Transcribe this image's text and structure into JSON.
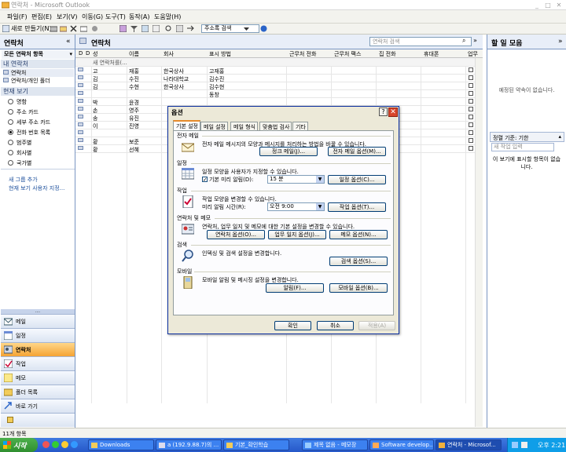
{
  "window": {
    "title": "연락처 - Microsoft Outlook",
    "icon": "outlook-icon"
  },
  "menu": [
    "파일(F)",
    "편집(E)",
    "보기(V)",
    "이동(G)",
    "도구(T)",
    "동작(A)",
    "도움말(H)"
  ],
  "toolbar": {
    "new_label": "새로 만들기(N)",
    "address_placeholder": "주소록 검색"
  },
  "nav": {
    "title": "연락처",
    "all_contacts_label": "모든 연락처 항목",
    "my_contacts_header": "내 연락처",
    "contacts_items": [
      "연락처",
      "연락처/개인 폴더"
    ],
    "current_view_header": "현재 보기",
    "views": [
      "명함",
      "주소 카드",
      "세부 주소 카드",
      "전화 번호 목록",
      "범주별",
      "회사별",
      "국가별"
    ],
    "selected_view": "전화 번호 목록",
    "links": [
      "새 그룹 추가",
      "현재 보기 사용자 지정..."
    ],
    "buttons": [
      {
        "label": "메일",
        "icon": "mail-icon"
      },
      {
        "label": "일정",
        "icon": "calendar-icon"
      },
      {
        "label": "연락처",
        "icon": "contacts-icon"
      },
      {
        "label": "작업",
        "icon": "tasks-icon"
      },
      {
        "label": "메모",
        "icon": "notes-icon"
      },
      {
        "label": "폴더 목록",
        "icon": "folder-icon"
      },
      {
        "label": "바로 가기",
        "icon": "shortcut-icon"
      }
    ],
    "active_button": "연락처"
  },
  "main": {
    "title": "연락처",
    "search_placeholder": "연락처 검색",
    "columns": [
      "성",
      "이름",
      "회사",
      "표시 방법",
      "근무처 전화",
      "근무처 팩스",
      "집 전화",
      "휴대폰",
      "업무"
    ],
    "new_row_placeholder": "새 연락처를(...",
    "rows": [
      {
        "last": "고",
        "first": "재홍",
        "company": "한국상사",
        "display": "고재홍"
      },
      {
        "last": "김",
        "first": "수진",
        "company": "나라대학교",
        "display": "김수진"
      },
      {
        "last": "김",
        "first": "수현",
        "company": "한국상사",
        "display": "김수현"
      },
      {
        "last": "",
        "first": "",
        "company": "",
        "display": "동창"
      },
      {
        "last": "박",
        "first": "윤경",
        "company": "",
        "display": ""
      },
      {
        "last": "손",
        "first": "영주",
        "company": "",
        "display": ""
      },
      {
        "last": "송",
        "first": "유진",
        "company": "",
        "display": ""
      },
      {
        "last": "이",
        "first": "진영",
        "company": "",
        "display": ""
      },
      {
        "last": "",
        "first": "",
        "company": "",
        "display": ""
      },
      {
        "last": "황",
        "first": "보준",
        "company": "",
        "display": ""
      },
      {
        "last": "황",
        "first": "선혜",
        "company": "",
        "display": ""
      }
    ]
  },
  "todo": {
    "title": "할 일 모음",
    "no_appointments": "예정된 약속이 없습니다.",
    "arrange_label": "정렬 기준: 기한",
    "new_task_placeholder": "새 작업 입력",
    "empty_message": "이 보기에 표시할 항목이 없습니다."
  },
  "status": {
    "item_count": "11개 항목"
  },
  "dialog": {
    "title": "옵션",
    "tabs": [
      "기본 설정",
      "메일 설정",
      "메일 형식",
      "맞춤법 검사",
      "기타"
    ],
    "active_tab": "기본 설정",
    "sections": {
      "mail": {
        "heading": "전자 메일",
        "desc": "전자 메일 메시지의 모양과 메시지를 처리하는 방법을 바꿀 수 있습니다.",
        "btn1": "정크 메일(J)...",
        "btn2": "전자 메일 옵션(M)..."
      },
      "calendar": {
        "heading": "일정",
        "desc": "일정 모양을 사용자가 지정할 수 있습니다.",
        "reminder_label": "기본 미리 알림(D):",
        "reminder_checked": true,
        "reminder_value": "15 분",
        "btn": "일정 옵션(C)..."
      },
      "tasks": {
        "heading": "작업",
        "desc": "작업 모양을 변경할 수 있습니다.",
        "time_label": "미리 알림 시간(R):",
        "time_value": "오전 9:00",
        "btn": "작업 옵션(T)..."
      },
      "contacts": {
        "heading": "연락처 및 메모",
        "desc": "연락처, 업무 일지 및 메모에 대한 기본 설정을 변경할 수 있습니다.",
        "btn1": "연락처 옵션(O)...",
        "btn2": "업무 일지 옵션(J)...",
        "btn3": "메모 옵션(N)..."
      },
      "search": {
        "heading": "검색",
        "desc": "인덱싱 및 검색 설정을 변경합니다.",
        "btn": "검색 옵션(S)..."
      },
      "mobile": {
        "heading": "모바일",
        "desc": "모바일 알림 및 메시징 설정을 변경합니다.",
        "btn1": "알림(F)...",
        "btn2": "모바일 옵션(B)..."
      }
    },
    "ok_label": "확인",
    "cancel_label": "취소",
    "apply_label": "적용(A)"
  },
  "taskbar": {
    "start_label": "시작",
    "tasks": [
      {
        "label": "Downloads"
      },
      {
        "label": "a (192.9.88.7)의 ..."
      },
      {
        "label": "기본_확인학습"
      },
      {
        "label": "제목 없음 - 메모장"
      },
      {
        "label": "Software develop..."
      },
      {
        "label": "연락처 - Microsof..."
      }
    ],
    "clock": "오후 2:21"
  },
  "colors": {
    "accent": "#7a96c2",
    "active_nav": "#f5a333",
    "taskbar": "#2658c9",
    "dialog_bg": "#ece9d8"
  }
}
